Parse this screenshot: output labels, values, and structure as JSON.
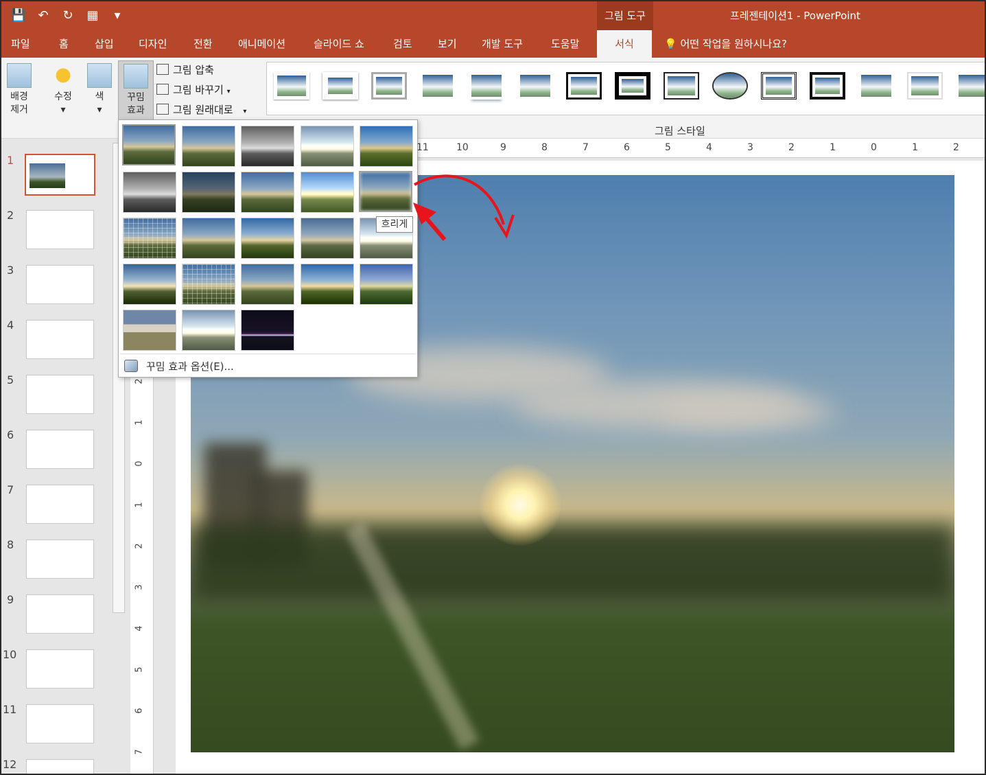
{
  "title_bar": {
    "qat": [
      "save-icon",
      "undo-icon",
      "redo-icon",
      "presentation-icon",
      "customize-icon"
    ],
    "tool_context": "그림 도구",
    "document_title": "프레젠테이션1  -  PowerPoint"
  },
  "tabs": [
    "파일",
    "홈",
    "삽입",
    "디자인",
    "전환",
    "애니메이션",
    "슬라이드 쇼",
    "검토",
    "보기",
    "개발 도구",
    "도움말",
    "서식"
  ],
  "active_tab": "서식",
  "tell_me": "어떤 작업을 원하시나요?",
  "ribbon": {
    "remove_bg_line1": "배경",
    "remove_bg_line2": "제거",
    "corrections": "수정",
    "color": "색",
    "artistic_line1": "꾸밈",
    "artistic_line2": "효과",
    "compress": "그림 압축",
    "change": "그림 바꾸기",
    "reset": "그림 원래대로",
    "styles_group_label": "그림 스타일"
  },
  "slides": {
    "numbers": [
      "1",
      "2",
      "3",
      "4",
      "5",
      "6",
      "7",
      "8",
      "9",
      "10",
      "11",
      "12"
    ],
    "selected": 1
  },
  "ruler": {
    "horizontal": [
      "11",
      "10",
      "9",
      "8",
      "7",
      "6",
      "5",
      "4",
      "3",
      "2",
      "1",
      "0",
      "1",
      "2"
    ],
    "vertical": [
      "2",
      "1",
      "0",
      "1",
      "2",
      "3",
      "4",
      "5",
      "6",
      "7"
    ]
  },
  "artistic_effects": {
    "items": [
      "none",
      "pencil-sketch",
      "line-drawing",
      "chalk",
      "paint-strokes",
      "sketch",
      "film-grain",
      "glow-diffused",
      "glow-edges",
      "blur",
      "mosaic",
      "cutout",
      "pastels",
      "watercolor",
      "light-screen",
      "crisscross",
      "texturizer",
      "plastic",
      "glass",
      "photocopy",
      "posterize",
      "marker",
      "neon"
    ],
    "selected_index": 0,
    "hover_index": 9,
    "tooltip": "흐리게",
    "options_label": "꾸밈 효과 옵션(E)..."
  },
  "colors": {
    "accent": "#b7472a",
    "annotation_arrow": "#e8141b"
  }
}
